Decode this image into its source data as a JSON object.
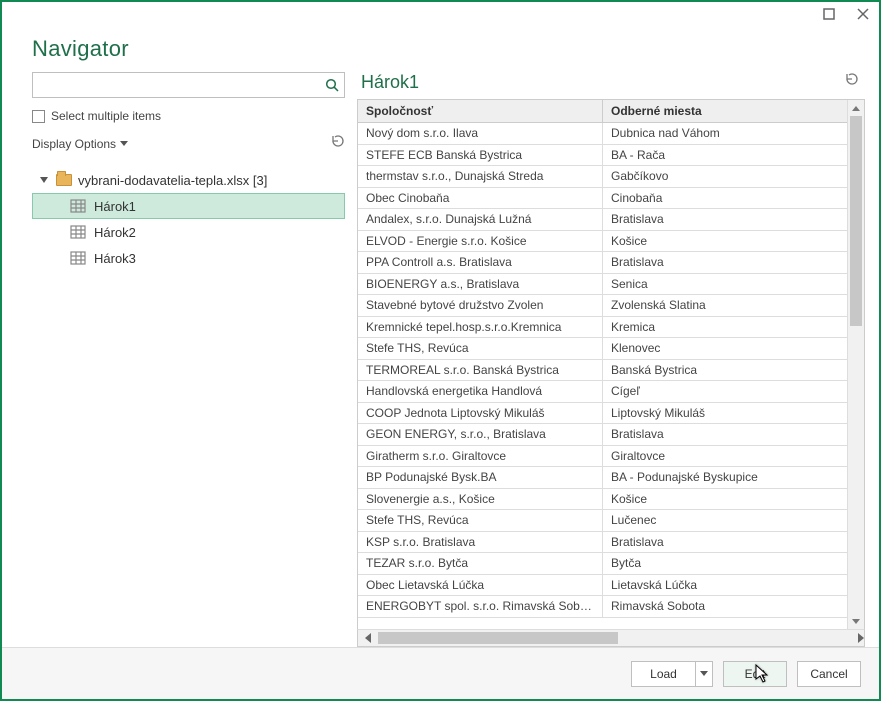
{
  "title": "Navigator",
  "left": {
    "search_placeholder": "",
    "multi_label": "Select multiple items",
    "display_options": "Display Options",
    "file_label": "vybrani-dodavatelia-tepla.xlsx [3]",
    "sheets": [
      "Hárok1",
      "Hárok2",
      "Hárok3"
    ],
    "selected_index": 0
  },
  "preview": {
    "title": "Hárok1",
    "columns": [
      "Spoločnosť",
      "Odberné miesta"
    ],
    "rows": [
      [
        "Nový dom s.r.o. Ilava",
        "Dubnica nad Váhom"
      ],
      [
        "STEFE ECB Banská Bystrica",
        "BA - Rača"
      ],
      [
        "thermstav s.r.o., Dunajská Streda",
        "Gabčíkovo"
      ],
      [
        "Obec Cinobaňa",
        "Cinobaňa"
      ],
      [
        "Andalex, s.r.o. Dunajská Lužná",
        "Bratislava"
      ],
      [
        "ELVOD - Energie s.r.o. Košice",
        "Košice"
      ],
      [
        "PPA Controll a.s. Bratislava",
        "Bratislava"
      ],
      [
        "BIOENERGY a.s., Bratislava",
        "Senica"
      ],
      [
        "Stavebné bytové družstvo Zvolen",
        "Zvolenská Slatina"
      ],
      [
        "Kremnické tepel.hosp.s.r.o.Kremnica",
        "Kremica"
      ],
      [
        "Stefe THS, Revúca",
        "Klenovec"
      ],
      [
        "TERMOREAL s.r.o. Banská Bystrica",
        "Banská Bystrica"
      ],
      [
        "Handlovská energetika Handlová",
        "Cígeľ"
      ],
      [
        "COOP Jednota Liptovský Mikuláš",
        "Liptovský Mikuláš"
      ],
      [
        "GEON ENERGY, s.r.o., Bratislava",
        "Bratislava"
      ],
      [
        "Giratherm s.r.o. Giraltovce",
        "Giraltovce"
      ],
      [
        "BP Podunajské Bysk.BA",
        "BA - Podunajské Byskupice"
      ],
      [
        "Slovenergie a.s., Košice",
        "Košice"
      ],
      [
        "Stefe THS, Revúca",
        "Lučenec"
      ],
      [
        "KSP s.r.o. Bratislava",
        "Bratislava"
      ],
      [
        "TEZAR s.r.o. Bytča",
        "Bytča"
      ],
      [
        "Obec Lietavská Lúčka",
        "Lietavská Lúčka"
      ],
      [
        "ENERGOBYT spol. s.r.o. Rimavská Sobota",
        "Rimavská Sobota"
      ]
    ]
  },
  "footer": {
    "load": "Load",
    "edit": "Edit",
    "cancel": "Cancel"
  }
}
